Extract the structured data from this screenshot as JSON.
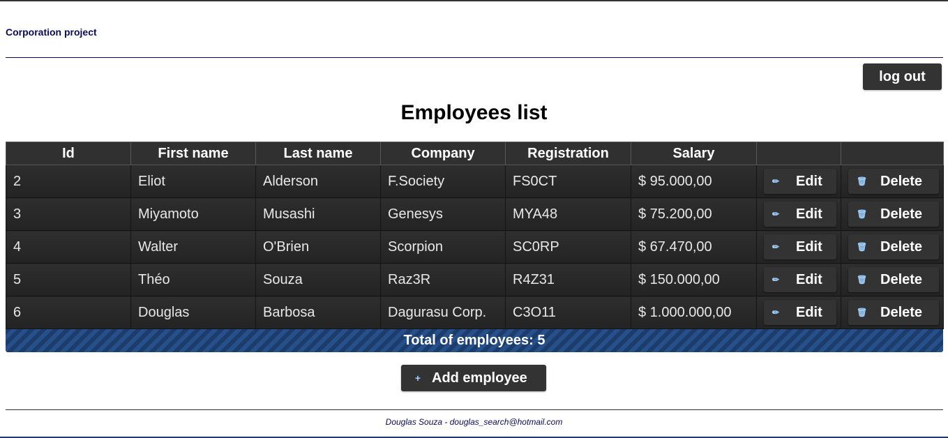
{
  "app": {
    "brand": "Corporation project"
  },
  "header": {
    "logout_label": "log out"
  },
  "main": {
    "title": "Employees list",
    "columns": [
      "Id",
      "First name",
      "Last name",
      "Company",
      "Registration",
      "Salary",
      "",
      ""
    ],
    "rows": [
      {
        "id": "2",
        "first_name": "Eliot",
        "last_name": "Alderson",
        "company": "F.Society",
        "registration": "FS0CT",
        "salary": "$ 95.000,00",
        "edit_label": "Edit",
        "delete_label": "Delete"
      },
      {
        "id": "3",
        "first_name": "Miyamoto",
        "last_name": "Musashi",
        "company": "Genesys",
        "registration": "MYA48",
        "salary": "$ 75.200,00",
        "edit_label": "Edit",
        "delete_label": "Delete"
      },
      {
        "id": "4",
        "first_name": "Walter",
        "last_name": "O'Brien",
        "company": "Scorpion",
        "registration": "SC0RP",
        "salary": "$ 67.470,00",
        "edit_label": "Edit",
        "delete_label": "Delete"
      },
      {
        "id": "5",
        "first_name": "Théo",
        "last_name": "Souza",
        "company": "Raz3R",
        "registration": "R4Z31",
        "salary": "$ 150.000,00",
        "edit_label": "Edit",
        "delete_label": "Delete"
      },
      {
        "id": "6",
        "first_name": "Douglas",
        "last_name": "Barbosa",
        "company": "Dagurasu Corp.",
        "registration": "C3O11",
        "salary": "$ 1.000.000,00",
        "edit_label": "Edit",
        "delete_label": "Delete"
      }
    ],
    "total_label": "Total of employees: 5",
    "add_label": "Add employee"
  },
  "icons": {
    "edit": "pencil-icon",
    "delete": "trash-icon",
    "add": "plus-icon"
  },
  "colors": {
    "accent": "#1c3d6b",
    "button": "#333333",
    "brand_text": "#0a0a5a"
  },
  "footer": {
    "text": "Douglas Souza - douglas_search@hotmail.com"
  }
}
